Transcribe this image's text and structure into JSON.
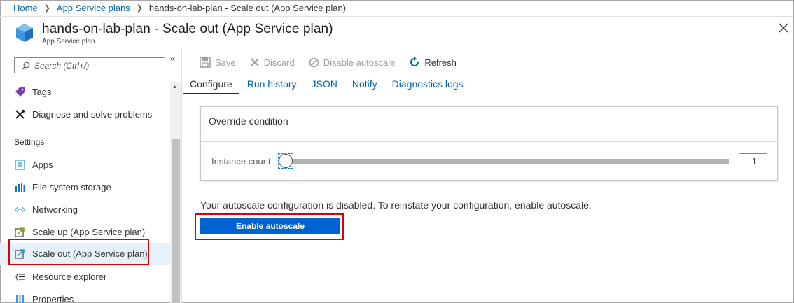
{
  "breadcrumb": {
    "home": "Home",
    "plans": "App Service plans",
    "current": "hands-on-lab-plan - Scale out (App Service plan)"
  },
  "header": {
    "title": "hands-on-lab-plan - Scale out (App Service plan)",
    "subtitle": "App Service plan",
    "icon": "cube-icon"
  },
  "leftnav": {
    "search_placeholder": "Search (Ctrl+/)",
    "collapse_glyph": "«",
    "items_top": [
      {
        "label": "Tags",
        "icon": "tag-icon"
      },
      {
        "label": "Diagnose and solve problems",
        "icon": "wrench-icon"
      }
    ],
    "section_label": "Settings",
    "settings_items": [
      {
        "label": "Apps",
        "icon": "apps-icon"
      },
      {
        "label": "File system storage",
        "icon": "storage-icon"
      },
      {
        "label": "Networking",
        "icon": "networking-icon"
      },
      {
        "label": "Scale up (App Service plan)",
        "icon": "scale-up-icon"
      },
      {
        "label": "Scale out (App Service plan)",
        "icon": "scale-out-icon",
        "selected": true
      },
      {
        "label": "Resource explorer",
        "icon": "resource-explorer-icon"
      },
      {
        "label": "Properties",
        "icon": "properties-icon"
      }
    ]
  },
  "toolbar": {
    "save": "Save",
    "discard": "Discard",
    "disable_autoscale": "Disable autoscale",
    "refresh": "Refresh"
  },
  "tabs": [
    {
      "label": "Configure",
      "active": true
    },
    {
      "label": "Run history"
    },
    {
      "label": "JSON"
    },
    {
      "label": "Notify"
    },
    {
      "label": "Diagnostics logs"
    }
  ],
  "override": {
    "heading": "Override condition",
    "instance_label": "Instance count",
    "instance_count": "1"
  },
  "message": "Your autoscale configuration is disabled. To reinstate your configuration, enable autoscale.",
  "enable_button": "Enable autoscale",
  "colors": {
    "link": "#0063b1",
    "primary_button": "#0063d1",
    "highlight_border": "#e00000",
    "selected_row": "#e5f1fb"
  }
}
